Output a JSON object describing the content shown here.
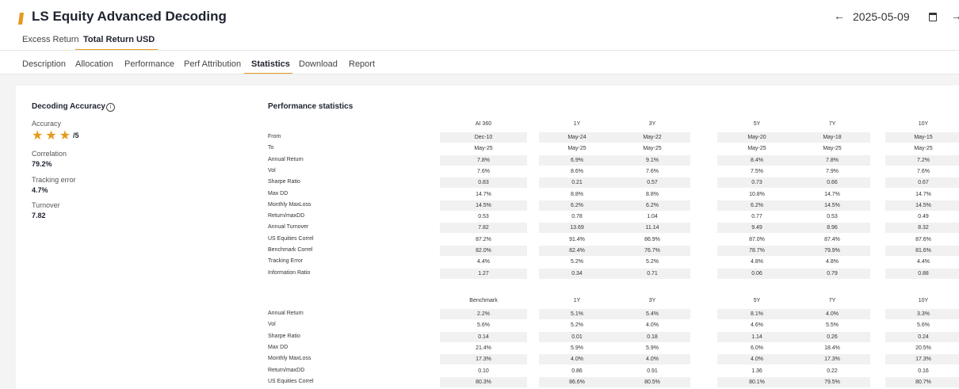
{
  "header": {
    "title": "LS Equity Advanced Decoding",
    "date": "2025-05-09",
    "brand_color": "#e59a1c"
  },
  "subtabs": [
    "Excess Return",
    "Total Return USD"
  ],
  "subtab_active": "Total Return USD",
  "tabs": [
    "Description",
    "Allocation",
    "Performance",
    "Perf Attribution",
    "Statistics",
    "Download",
    "Report"
  ],
  "tab_active": "Statistics",
  "decoding": {
    "heading": "Decoding Accuracy",
    "accuracy_label": "Accuracy",
    "stars": 3,
    "stars_suffix": "/5",
    "correlation_label": "Correlation",
    "correlation_value": "79.2%",
    "tracking_label": "Tracking error",
    "tracking_value": "4.7%",
    "turnover_label": "Turnover",
    "turnover_value": "7.82"
  },
  "stats": {
    "title": "Performance statistics",
    "table1": {
      "columns": [
        "AI 360",
        "1Y",
        "3Y",
        "5Y",
        "7Y",
        "10Y"
      ],
      "rows": [
        {
          "label": "From",
          "values": [
            "Dec-10",
            "May-24",
            "May-22",
            "May-20",
            "May-18",
            "May-15"
          ]
        },
        {
          "label": "To",
          "values": [
            "May-25",
            "May-25",
            "May-25",
            "May-25",
            "May-25",
            "May-25"
          ]
        },
        {
          "label": "Annual Return",
          "values": [
            "7.8%",
            "6.9%",
            "9.1%",
            "8.4%",
            "7.8%",
            "7.2%"
          ]
        },
        {
          "label": "Vol",
          "values": [
            "7.6%",
            "8.6%",
            "7.6%",
            "7.5%",
            "7.9%",
            "7.6%"
          ]
        },
        {
          "label": "Sharpe Ratio",
          "values": [
            "0.83",
            "0.21",
            "0.57",
            "0.73",
            "0.66",
            "0.67"
          ]
        },
        {
          "label": "Max DD",
          "values": [
            "14.7%",
            "8.8%",
            "8.8%",
            "10.8%",
            "14.7%",
            "14.7%"
          ]
        },
        {
          "label": "Monthly MaxLoss",
          "values": [
            "14.5%",
            "6.2%",
            "6.2%",
            "6.2%",
            "14.5%",
            "14.5%"
          ]
        },
        {
          "label": "Return/maxDD",
          "values": [
            "0.53",
            "0.78",
            "1.04",
            "0.77",
            "0.53",
            "0.49"
          ]
        },
        {
          "label": "Annual Turnover",
          "values": [
            "7.82",
            "13.69",
            "11.14",
            "9.49",
            "8.96",
            "8.32"
          ]
        },
        {
          "label": "US Equities Correl",
          "values": [
            "87.2%",
            "91.4%",
            "86.9%",
            "87.0%",
            "87.4%",
            "87.6%"
          ]
        },
        {
          "label": "Benchmark Correl",
          "values": [
            "82.0%",
            "82.4%",
            "76.7%",
            "78.7%",
            "79.9%",
            "81.6%"
          ]
        },
        {
          "label": "Tracking Error",
          "values": [
            "4.4%",
            "5.2%",
            "5.2%",
            "4.8%",
            "4.8%",
            "4.4%"
          ]
        },
        {
          "label": "Information Ratio",
          "values": [
            "1.27",
            "0.34",
            "0.71",
            "0.06",
            "0.79",
            "0.88"
          ]
        }
      ]
    },
    "table2": {
      "columns": [
        "Benchmark",
        "1Y",
        "3Y",
        "5Y",
        "7Y",
        "10Y"
      ],
      "rows": [
        {
          "label": "Annual Return",
          "values": [
            "2.2%",
            "5.1%",
            "5.4%",
            "8.1%",
            "4.0%",
            "3.3%"
          ]
        },
        {
          "label": "Vol",
          "values": [
            "5.6%",
            "5.2%",
            "4.0%",
            "4.6%",
            "5.5%",
            "5.6%"
          ]
        },
        {
          "label": "Sharpe Ratio",
          "values": [
            "0.14",
            "0.01",
            "0.18",
            "1.14",
            "0.26",
            "0.24"
          ]
        },
        {
          "label": "Max DD",
          "values": [
            "21.4%",
            "5.9%",
            "5.9%",
            "6.0%",
            "18.4%",
            "20.5%"
          ]
        },
        {
          "label": "Monthly MaxLoss",
          "values": [
            "17.3%",
            "4.0%",
            "4.0%",
            "4.0%",
            "17.3%",
            "17.3%"
          ]
        },
        {
          "label": "Return/maxDD",
          "values": [
            "0.10",
            "0.86",
            "0.91",
            "1.36",
            "0.22",
            "0.16"
          ]
        },
        {
          "label": "US Equities Correl",
          "values": [
            "80.3%",
            "86.6%",
            "80.5%",
            "80.1%",
            "79.5%",
            "80.7%"
          ]
        }
      ]
    }
  }
}
